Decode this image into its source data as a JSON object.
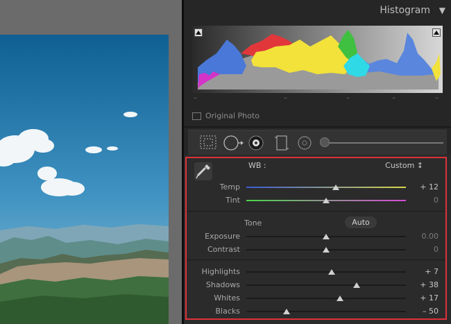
{
  "histogram": {
    "title": "Histogram",
    "toggle_icon": "triangle-down-icon",
    "info_dashes": [
      "–",
      "–",
      "–",
      "–",
      "–"
    ],
    "original_photo_label": "Original Photo"
  },
  "toolstrip": {
    "tools": [
      "crop-overlay-icon",
      "spot-removal-icon",
      "red-eye-icon",
      "graduated-filter-icon",
      "radial-filter-icon"
    ]
  },
  "basic": {
    "wb_label": "WB :",
    "wb_value": "Custom ↕",
    "tone_label": "Tone",
    "auto_label": "Auto",
    "rows": [
      {
        "id": "temp",
        "label": "Temp",
        "value": "+ 12",
        "position": 0.56
      },
      {
        "id": "tint",
        "label": "Tint",
        "value": "0",
        "position": 0.5
      },
      {
        "id": "exposure",
        "label": "Exposure",
        "value": "0.00",
        "position": 0.5
      },
      {
        "id": "contrast",
        "label": "Contrast",
        "value": "0",
        "position": 0.5
      },
      {
        "id": "highlights",
        "label": "Highlights",
        "value": "+ 7",
        "position": 0.535
      },
      {
        "id": "shadows",
        "label": "Shadows",
        "value": "+ 38",
        "position": 0.69
      },
      {
        "id": "whites",
        "label": "Whites",
        "value": "+ 17",
        "position": 0.585
      },
      {
        "id": "blacks",
        "label": "Blacks",
        "value": "– 50",
        "position": 0.25
      }
    ]
  },
  "colors": {
    "highlight_frame": "#e0323a",
    "panel_bg": "#2b2b2b"
  }
}
